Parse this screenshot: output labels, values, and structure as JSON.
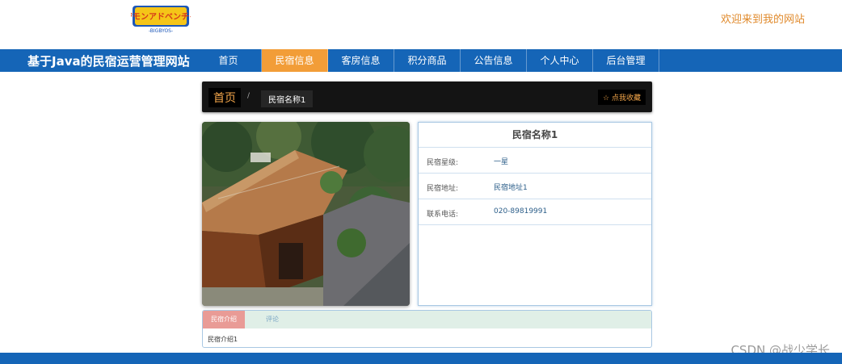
{
  "header": {
    "logo_text": "デジモンアドベンチャー",
    "logo_subtext": "-BIGBYOS-",
    "welcome": "欢迎来到我的网站"
  },
  "nav": {
    "site_title": "基于Java的民宿运营管理网站",
    "items": [
      {
        "label": "首页"
      },
      {
        "label": "民宿信息"
      },
      {
        "label": "客房信息"
      },
      {
        "label": "积分商品"
      },
      {
        "label": "公告信息"
      },
      {
        "label": "个人中心"
      },
      {
        "label": "后台管理"
      }
    ],
    "active_index": 1
  },
  "breadcrumb": {
    "home": "首页",
    "separator": "/",
    "current": "民宿名称1",
    "favorite_label": "点我收藏"
  },
  "detail": {
    "title": "民宿名称1",
    "rows": [
      {
        "label": "民宿星级:",
        "value": "一星"
      },
      {
        "label": "民宿地址:",
        "value": "民宿地址1"
      },
      {
        "label": "联系电话:",
        "value": "020-89819991"
      }
    ]
  },
  "tabs": {
    "items": [
      {
        "label": "民宿介绍"
      },
      {
        "label": "评论"
      }
    ],
    "content": "民宿介绍1"
  },
  "watermark": "CSDN @战少学长",
  "colors": {
    "nav_bg": "#1565b7",
    "nav_active": "#f29d38",
    "welcome": "#e08a2c",
    "breadcrumb_bg": "#141414",
    "tab_active": "#e99b96",
    "tab_bar": "#e0efe7"
  }
}
